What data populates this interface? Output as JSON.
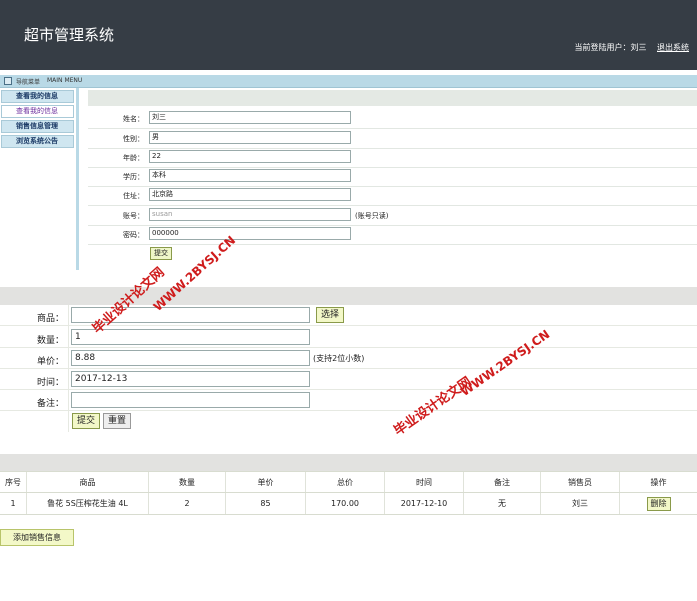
{
  "header": {
    "title": "超市管理系统",
    "login_prefix": "当前登陆用户：",
    "login_user": "刘三",
    "logout": "退出系统"
  },
  "nav": {
    "menu_cn": "导航菜单",
    "menu_en": "MAIN MENU"
  },
  "sidebar": {
    "items": [
      {
        "label": "查看我的信息"
      },
      {
        "label": "查看我的信息"
      },
      {
        "label": "销售信息管理"
      },
      {
        "label": "浏览系统公告"
      }
    ]
  },
  "profile": {
    "name_label": "姓名：",
    "name": "刘三",
    "gender_label": "性别：",
    "gender": "男",
    "age_label": "年龄：",
    "age": "22",
    "education_label": "学历：",
    "education": "本科",
    "address_label": "住址：",
    "address": "北京路",
    "account_label": "账号：",
    "account": "susan",
    "account_note": "(账号只读)",
    "password_label": "密码：",
    "password": "000000",
    "submit": "提交"
  },
  "sale_form": {
    "product_label": "商品：",
    "product": "",
    "select_button": "选择",
    "qty_label": "数量：",
    "qty": "1",
    "price_label": "单价：",
    "price": "8.88",
    "price_note": "(支持2位小数)",
    "time_label": "时间：",
    "time": "2017-12-13",
    "remark_label": "备注：",
    "remark": "",
    "submit": "提交",
    "reset": "重置"
  },
  "table": {
    "headers": [
      "序号",
      "商品",
      "数量",
      "单价",
      "总价",
      "时间",
      "备注",
      "销售员",
      "操作"
    ],
    "rows": [
      {
        "no": "1",
        "product": "鲁花 5S压榨花生油 4L",
        "qty": "2",
        "price": "85",
        "total": "170.00",
        "time": "2017-12-10",
        "remark": "无",
        "seller": "刘三",
        "action": "删除"
      }
    ]
  },
  "add_button": "添加销售信息",
  "watermark": {
    "cn": "毕业设计论文网",
    "url": "WWW.2BYSJ.CN"
  },
  "colors": {
    "header_bg": "#363d45",
    "accent_red": "#cf1c1c",
    "button_bg": "#f3f8c8"
  }
}
